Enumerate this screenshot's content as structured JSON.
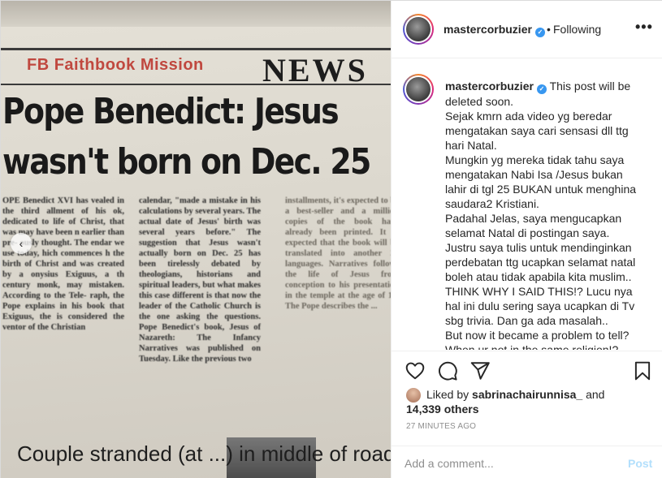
{
  "post": {
    "username": "mastercorbuzier",
    "follow_status": "Following",
    "separator": "•",
    "more_label": "•••"
  },
  "media": {
    "newspaper": {
      "mission": "FB  Faithbook Mission",
      "masthead": "NEWS",
      "headline_line1": "Pope Benedict: Jesus",
      "headline_line2": "wasn't born on Dec. 25",
      "column1": "OPE Benedict XVI has vealed in the third allment of his ok, dedicated to life of Christ, that was may have been n earlier than pre- ously thought. The endar we use today, hich commences h the birth of Christ and was created by a onysius Exiguus, a th century monk, may mistaken. According to the Tele- raph, the Pope explains in his book that Exiguus, the is considered the ventor of the Christian",
      "column2": "calendar, \"made a mistake in his calculations by several years. The actual date of Jesus' birth was several years before.\" The suggestion that Jesus wasn't actually born on Dec. 25 has been tirelessly debated by theologians, historians and spiritual leaders, but what makes this case different is that now the leader of the Catholic Church is the one asking the questions. Pope Benedict's book, Jesus of Nazareth: The Infancy Narratives was published on Tuesday. Like the previous two",
      "column3": "installments, it's expected to be a best-seller and a million copies of the book have already been printed. It is expected that the book will be translated into another 20 languages. Narratives follows the life of Jesus from conception to his presentation in the temple at the age of 12. The Pope describes the ...",
      "caption": "Couple stranded (at ...) in middle of road"
    },
    "prev_label": "‹"
  },
  "caption": {
    "username": "mastercorbuzier",
    "paragraphs": [
      "This post will be deleted soon.",
      "Sejak kmrn ada video yg beredar mengatakan saya cari sensasi dll ttg hari Natal.",
      "Mungkin yg mereka tidak tahu saya mengatakan Nabi Isa /Jesus bukan lahir di tgl 25 BUKAN untuk menghina saudara2 Kristiani.",
      "Padahal Jelas, saya mengucapkan selamat Natal di postingan saya.",
      "Justru saya tulis untuk mendinginkan perdebatan ttg ucapkan selamat natal boleh atau tidak apabila kita muslim.. THINK WHY I SAID THIS!? Lucu nya hal ini dulu sering saya ucapkan di Tv sbg trivia. Dan ga ada masalah..",
      "But now it became a problem to tell?",
      "When ur not in the same religion!?"
    ]
  },
  "actions": {
    "like_icon": "heart-icon",
    "comment_icon": "comment-icon",
    "share_icon": "paper-plane-icon",
    "save_icon": "bookmark-icon"
  },
  "likes": {
    "prefix": "Liked by",
    "liker": "sabrinachairunnisa_",
    "joiner": "and",
    "others": "14,339 others"
  },
  "timestamp": "27 MINUTES AGO",
  "add_comment": {
    "placeholder": "Add a comment...",
    "post_label": "Post"
  },
  "colors": {
    "accent": "#3897f0",
    "post_disabled": "#b2dffc",
    "muted": "#8e8e8e",
    "text": "#262626"
  }
}
